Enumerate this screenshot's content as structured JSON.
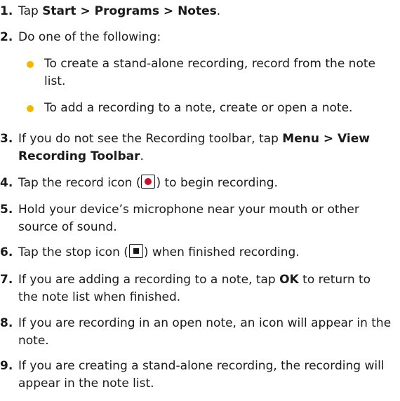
{
  "steps": [
    {
      "num": "1.",
      "t0": "Tap ",
      "b0": "Start > Programs > Notes",
      "t1": "."
    },
    {
      "num": "2.",
      "t0": "Do one of the following:",
      "bullets": [
        "To create a stand-alone recording, record from the note list.",
        "To add a recording to a note, create or open a note."
      ],
      "bullet_color": "#f2b800"
    },
    {
      "num": "3.",
      "t0": "If you do not see the Recording toolbar, tap ",
      "b0": "Menu > View Recording Toolbar",
      "t1": "."
    },
    {
      "num": "4.",
      "t0": "Tap the record icon (",
      "icon": "record-icon",
      "t1": ") to begin recording."
    },
    {
      "num": "5.",
      "t0": "Hold your device’s microphone near your mouth or other source of sound."
    },
    {
      "num": "6.",
      "t0": "Tap the stop icon (",
      "icon": "stop-icon",
      "t1": ") when finished recording."
    },
    {
      "num": "7.",
      "t0": "If you are adding a recording to a note, tap ",
      "b0": "OK",
      "t1": " to return to the note list when finished."
    },
    {
      "num": "8.",
      "t0": "If you are recording in an open note, an icon will appear in the note."
    },
    {
      "num": "9.",
      "t0": "If you are creating a stand-alone recording, the recording will appear in the note list."
    }
  ],
  "colors": {
    "record": "#c8102e",
    "text": "#1a1a1a"
  }
}
